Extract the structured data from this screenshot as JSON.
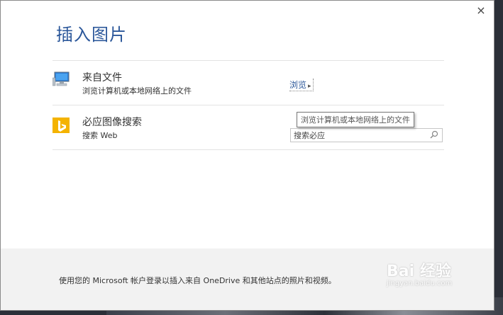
{
  "dialog": {
    "title": "插入图片",
    "close_glyph": "×"
  },
  "sources": [
    {
      "name": "来自文件",
      "description": "浏览计算机或本地网络上的文件",
      "icon": "computer-icon",
      "action_label": "浏览",
      "action_arrow": "▸"
    },
    {
      "name": "必应图像搜索",
      "description": "搜索 Web",
      "icon": "bing-icon",
      "search_value": "搜索必应",
      "search_icon": "search-icon"
    }
  ],
  "tooltip": "浏览计算机或本地网络上的文件",
  "footer": {
    "text": "使用您的 Microsoft 帐户登录以插入来自 OneDrive 和其他站点的照片和视频。"
  },
  "watermark": {
    "logo_text": "Bai 经验",
    "url": "jingyan.baidu.com"
  },
  "colors": {
    "title_blue": "#2b579a",
    "bing_orange": "#f4b300",
    "footer_bg": "#f2f2f2"
  }
}
